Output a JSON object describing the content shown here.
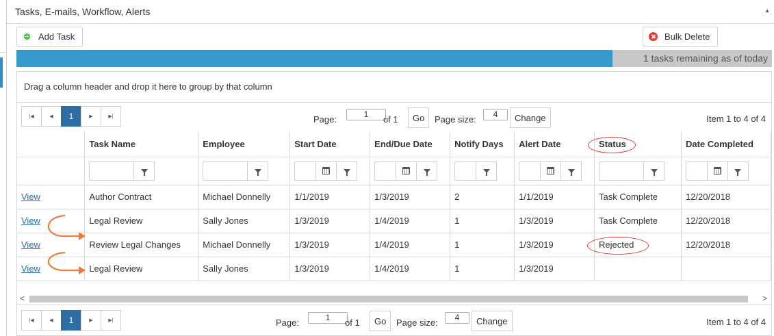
{
  "panel": {
    "title": "Tasks, E-mails, Workflow, Alerts"
  },
  "toolbar": {
    "add_task": "Add Task",
    "bulk_delete": "Bulk Delete"
  },
  "progress": {
    "fraction": 0.789,
    "text": "1 tasks remaining as of today"
  },
  "grid": {
    "group_hint": "Drag a column header and drop it here to group by that column",
    "columns": [
      "Task Name",
      "Employee",
      "Start Date",
      "End/Due Date",
      "Notify Days",
      "Alert Date",
      "Status",
      "Date Completed"
    ],
    "rows": [
      {
        "view": "View",
        "task": "Author Contract",
        "employee": "Michael Donnelly",
        "start": "1/1/2019",
        "end": "1/3/2019",
        "notify": "2",
        "alert": "1/1/2019",
        "status": "Task Complete",
        "completed": "12/20/2018"
      },
      {
        "view": "View",
        "task": "Legal Review",
        "employee": "Sally Jones",
        "start": "1/3/2019",
        "end": "1/4/2019",
        "notify": "1",
        "alert": "1/3/2019",
        "status": "Task Complete",
        "completed": "12/20/2018"
      },
      {
        "view": "View",
        "task": "Review Legal Changes",
        "employee": "Michael Donnelly",
        "start": "1/3/2019",
        "end": "1/4/2019",
        "notify": "1",
        "alert": "1/3/2019",
        "status": "Rejected",
        "completed": "12/20/2018"
      },
      {
        "view": "View",
        "task": "Legal Review",
        "employee": "Sally Jones",
        "start": "1/3/2019",
        "end": "1/4/2019",
        "notify": "1",
        "alert": "1/3/2019",
        "status": "",
        "completed": ""
      }
    ]
  },
  "pager": {
    "current": "1",
    "page_label": "Page:",
    "page_value": "1",
    "of": "of 1",
    "go": "Go",
    "size_label": "Page size:",
    "size_value": "4",
    "change": "Change",
    "info": "Item 1 to 4 of 4"
  },
  "colors": {
    "accent": "#3499cc",
    "pager_active": "#2e6ca4",
    "annotation": "#e53935",
    "arrow": "#f07b3a"
  }
}
